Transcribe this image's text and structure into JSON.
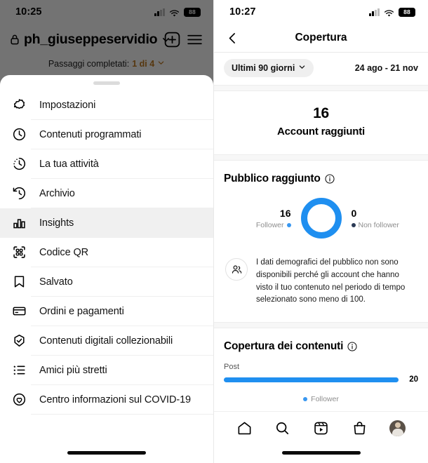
{
  "left": {
    "status": {
      "time": "10:25",
      "battery": "88",
      "signal_icon": "cellular-signal-icon",
      "wifi_icon": "wifi-icon"
    },
    "header": {
      "lock_icon": "lock-icon",
      "username": "ph_giuseppeservidio",
      "chevron_icon": "chevron-down-icon",
      "add_icon": "plus-square-icon",
      "menu_icon": "hamburger-menu-icon"
    },
    "steps": {
      "prefix": "Passaggi completati:",
      "value": "1 di 4",
      "chevron_icon": "chevron-down-icon"
    },
    "sheet": {
      "grabber": "drag-handle",
      "items": [
        {
          "label": "Impostazioni",
          "icon": "gear-icon",
          "active": false
        },
        {
          "label": "Contenuti programmati",
          "icon": "clock-icon",
          "active": false
        },
        {
          "label": "La tua attività",
          "icon": "activity-clock-icon",
          "active": false
        },
        {
          "label": "Archivio",
          "icon": "history-icon",
          "active": false
        },
        {
          "label": "Insights",
          "icon": "bar-chart-icon",
          "active": true
        },
        {
          "label": "Codice QR",
          "icon": "qr-code-icon",
          "active": false
        },
        {
          "label": "Salvato",
          "icon": "bookmark-icon",
          "active": false
        },
        {
          "label": "Ordini e pagamenti",
          "icon": "credit-card-icon",
          "active": false
        },
        {
          "label": "Contenuti digitali collezionabili",
          "icon": "shield-check-icon",
          "active": false
        },
        {
          "label": "Amici più stretti",
          "icon": "list-star-icon",
          "active": false
        },
        {
          "label": "Centro informazioni sul COVID-19",
          "icon": "covid-info-icon",
          "active": false
        }
      ]
    }
  },
  "right": {
    "status": {
      "time": "10:27",
      "battery": "88",
      "signal_icon": "cellular-signal-icon",
      "wifi_icon": "wifi-icon"
    },
    "nav": {
      "back_icon": "chevron-left-icon",
      "title": "Copertura"
    },
    "filter": {
      "period_label": "Ultimi 90 giorni",
      "period_chevron": "chevron-down-icon",
      "date_range": "24 ago - 21 nov"
    },
    "summary": {
      "value": "16",
      "label": "Account raggiunti"
    },
    "audience": {
      "title": "Pubblico raggiunto",
      "info_icon": "info-circle-icon",
      "notice_icon": "people-icon",
      "notice": "I dati demografici del pubblico non sono disponibili perché gli account che hanno visto il tuo contenuto nel periodo di tempo selezionato sono meno di 100."
    },
    "content_reach": {
      "title": "Copertura dei contenuti",
      "info_icon": "info-circle-icon",
      "bar_label": "Post",
      "bar_value": "20",
      "legend": "Follower"
    },
    "tabs": [
      {
        "icon": "home-icon"
      },
      {
        "icon": "search-icon"
      },
      {
        "icon": "reels-icon"
      },
      {
        "icon": "shop-bag-icon"
      },
      {
        "icon": "profile-avatar"
      }
    ],
    "colors": {
      "accent_blue": "#1f8ff0",
      "follower_blue": "#3897f0",
      "nonfollower_navy": "#2b3a55"
    }
  },
  "chart_data": [
    {
      "type": "pie",
      "title": "Pubblico raggiunto",
      "categories": [
        "Follower",
        "Non follower"
      ],
      "values": [
        16,
        0
      ],
      "labels": [
        "16",
        "0"
      ],
      "legend_position": "sides",
      "colors": [
        "#1f8ff0",
        "#2b3a55"
      ]
    },
    {
      "type": "bar",
      "title": "Copertura dei contenuti",
      "categories": [
        "Post"
      ],
      "values": [
        20
      ],
      "series": [
        {
          "name": "Follower",
          "values": [
            20
          ]
        }
      ],
      "xlabel": "",
      "ylabel": "",
      "xlim": [
        0,
        20
      ],
      "grid": false,
      "legend_position": "bottom",
      "colors": [
        "#1f8ff0"
      ]
    }
  ]
}
